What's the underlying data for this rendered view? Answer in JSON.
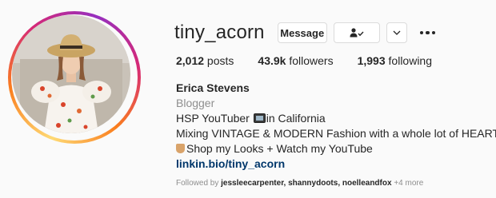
{
  "profile": {
    "username": "tiny_acorn",
    "message_label": "Message",
    "follow_icon": "person-check-icon",
    "chevron_icon": "chevron-down-icon",
    "more_icon": "more-options-icon"
  },
  "stats": {
    "posts_count": "2,012",
    "posts_label": " posts",
    "followers_count": "43.9k",
    "followers_label": " followers",
    "following_count": "1,993",
    "following_label": " following"
  },
  "bio": {
    "name": "Erica Stevens",
    "category": "Blogger",
    "line1_pre": "HSP YouTuber ",
    "line1_post": "in California",
    "line2": "Mixing VINTAGE & MODERN Fashion with a whole lot of HEART ",
    "heart": "❤️",
    "line3": "Shop my Looks + Watch my YouTube",
    "link": "linkin.bio/tiny_acorn"
  },
  "followed_by": {
    "prefix": "Followed by ",
    "names": "jessleecarpenter, shannydoots, noelleandfox",
    "more": " +4 more"
  }
}
